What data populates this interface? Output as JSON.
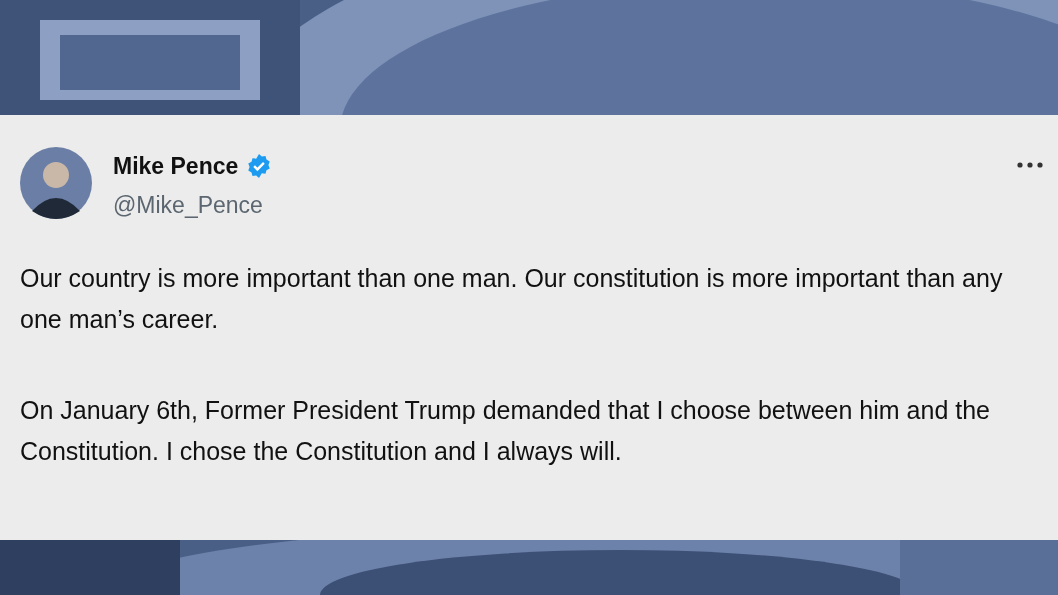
{
  "tweet": {
    "author": {
      "name": "Mike Pence",
      "verified": true,
      "handle": "@Mike_Pence"
    },
    "paragraphs": [
      "Our country is more important than one man. Our constitution is more important than any one man’s career.",
      "On January 6th, Former President Trump demanded that I choose between him and the Constitution. I chose the Constitution and I always will."
    ]
  }
}
